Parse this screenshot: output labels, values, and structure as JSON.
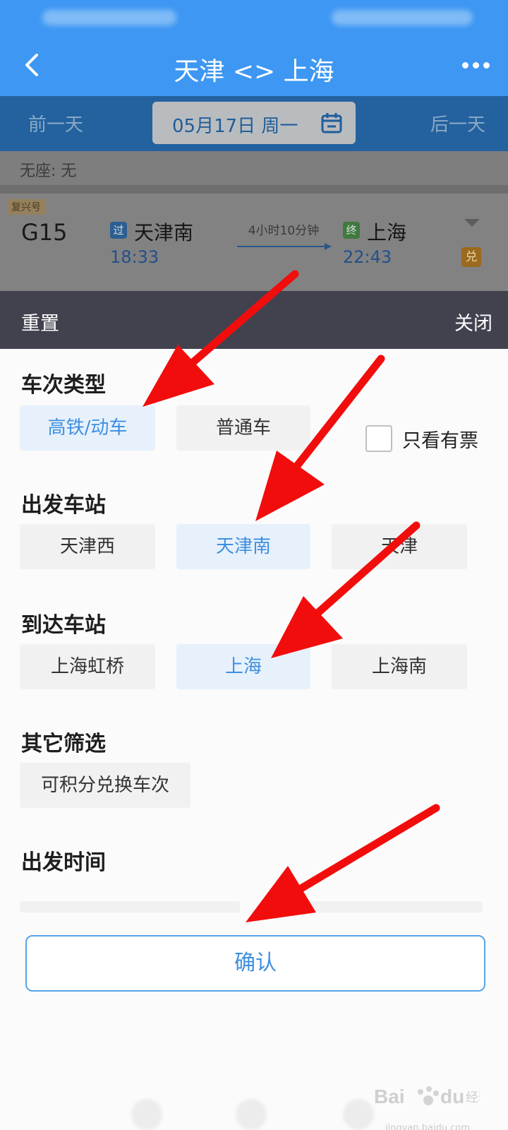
{
  "nav": {
    "title": "天津 <> 上海"
  },
  "date_bar": {
    "prev_label": "前一天",
    "date_label": "05月17日 周一",
    "next_label": "后一天"
  },
  "seat_info": "无座: 无",
  "train": {
    "tag": "复兴号",
    "number": "G15",
    "from_badge": "过",
    "from_station": "天津南",
    "dep_time": "18:33",
    "duration": "4小时10分钟",
    "to_badge": "终",
    "to_station": "上海",
    "arr_time": "22:43",
    "exchange_badge": "兑"
  },
  "panel": {
    "reset_label": "重置",
    "close_label": "关闭",
    "train_type": {
      "title": "车次类型",
      "options": [
        "高铁/动车",
        "普通车"
      ],
      "selected": "高铁/动车"
    },
    "ticket_only_label": "只看有票",
    "departure": {
      "title": "出发车站",
      "options": [
        "天津西",
        "天津南",
        "天津"
      ],
      "selected": "天津南"
    },
    "arrival": {
      "title": "到达车站",
      "options": [
        "上海虹桥",
        "上海",
        "上海南"
      ],
      "selected": "上海"
    },
    "other": {
      "title": "其它筛选",
      "options": [
        "可积分兑换车次"
      ]
    },
    "time": {
      "title": "出发时间"
    },
    "confirm_label": "确认"
  },
  "watermark": {
    "text": "jingyan.baidu.com"
  },
  "colors": {
    "primary": "#3d97f3",
    "accent": "#3d8fe0",
    "header_dark": "#42424f",
    "arrow": "#f20d0d"
  }
}
